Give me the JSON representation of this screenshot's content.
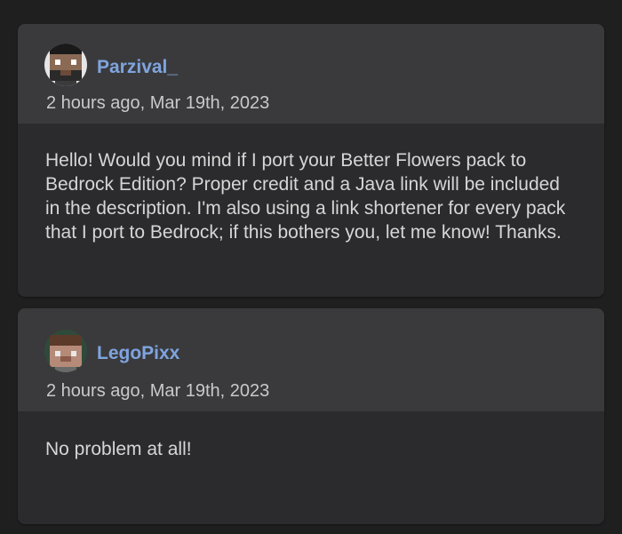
{
  "comments": [
    {
      "username": "Parzival_",
      "timestamp": "2 hours ago, Mar 19th, 2023",
      "body": "Hello! Would you mind if I port your Better Flowers pack to Bedrock Edition? Proper credit and a Java link will be included in the description. I'm also using a link shortener for every pack that I port to Bedrock; if this bothers you, let me know! Thanks."
    },
    {
      "username": "LegoPixx",
      "timestamp": "2 hours ago, Mar 19th, 2023",
      "body": "No problem at all!"
    }
  ],
  "colors": {
    "page_background": "#1f1f1f",
    "card_header": "#3a3a3c",
    "card_body": "#2b2b2d",
    "username": "#7fa4de",
    "timestamp": "#c9c9c9",
    "body_text": "#d6d6d6"
  }
}
